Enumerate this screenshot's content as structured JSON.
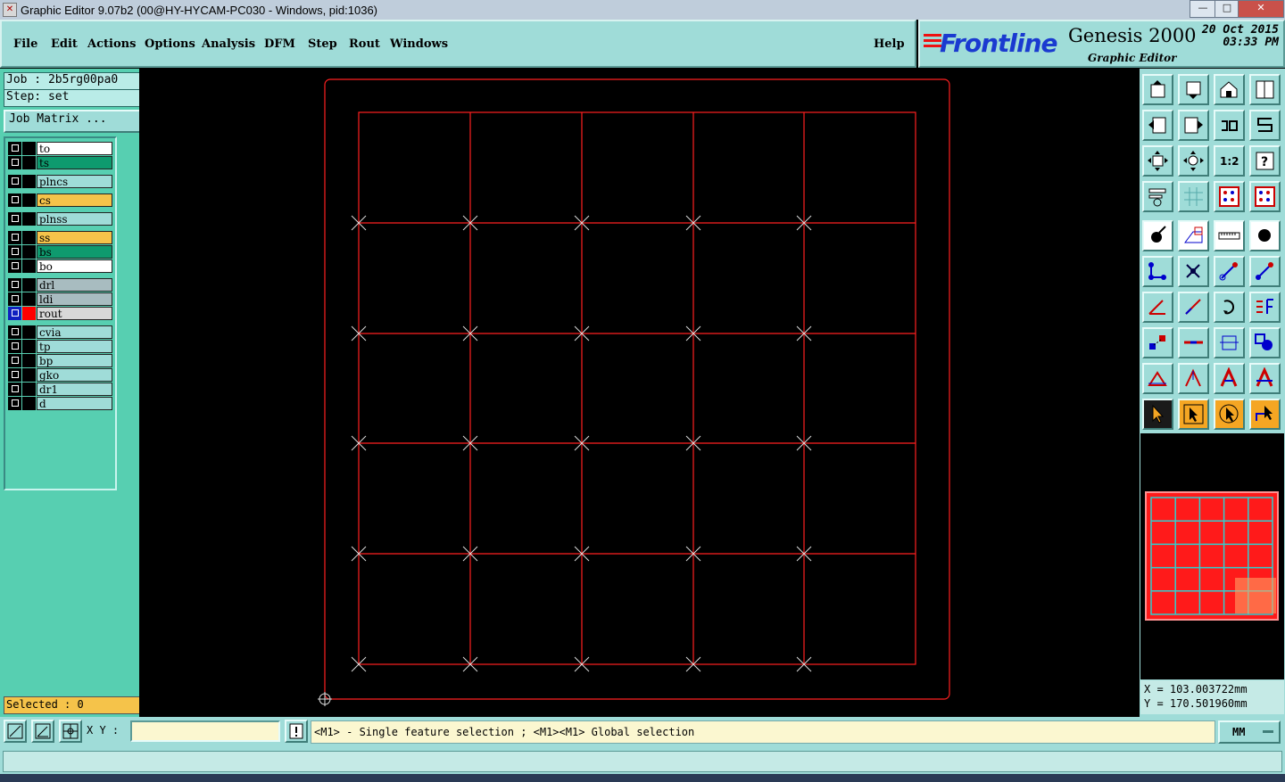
{
  "window": {
    "title": "Graphic Editor 9.07b2 (00@HY-HYCAM-PC030 - Windows, pid:1036)",
    "minimize": "—",
    "maximize": "□",
    "close": "✕"
  },
  "menubar": {
    "items": [
      "File",
      "Edit",
      "Actions",
      "Options",
      "Analysis",
      "DFM",
      "Step",
      "Rout",
      "Windows"
    ],
    "help": "Help"
  },
  "brand": {
    "logo": "Frontline",
    "app": "Genesis 2000",
    "subtitle": "Graphic Editor",
    "date": "20 Oct 2015",
    "time": "03:33 PM"
  },
  "job": {
    "job_label": "Job : 2b5rg00pa0",
    "step_label": "Step: set",
    "matrix_button": "Job Matrix ..."
  },
  "layers": [
    {
      "name": "to",
      "color": "#ffffff",
      "swatch": "#000000"
    },
    {
      "name": "ts",
      "color": "#0e9a6e",
      "swatch": "#000000"
    },
    {
      "name": "plncs",
      "color": "#9fdcd8",
      "swatch": "#000000"
    },
    {
      "name": "cs",
      "color": "#f5c34a",
      "swatch": "#000000"
    },
    {
      "name": "plnss",
      "color": "#9fdcd8",
      "swatch": "#000000"
    },
    {
      "name": "ss",
      "color": "#f5c34a",
      "swatch": "#000000"
    },
    {
      "name": "bs",
      "color": "#0e9a6e",
      "swatch": "#000000"
    },
    {
      "name": "bo",
      "color": "#ffffff",
      "swatch": "#000000"
    },
    {
      "name": "drl",
      "color": "#a8bcc0",
      "swatch": "#000000"
    },
    {
      "name": "ldi",
      "color": "#a8bcc0",
      "swatch": "#000000"
    },
    {
      "name": "rout",
      "color": "#d8d8d8",
      "swatch": "#ff0000",
      "active": true
    },
    {
      "name": "cvia",
      "color": "#9fdcd8",
      "swatch": "#000000"
    },
    {
      "name": "tp",
      "color": "#9fdcd8",
      "swatch": "#000000"
    },
    {
      "name": "bp",
      "color": "#9fdcd8",
      "swatch": "#000000"
    },
    {
      "name": "gko",
      "color": "#9fdcd8",
      "swatch": "#000000"
    },
    {
      "name": "dr1",
      "color": "#9fdcd8",
      "swatch": "#000000"
    },
    {
      "name": "d",
      "color": "#9fdcd8",
      "swatch": "#000000"
    }
  ],
  "selected_label": "Selected : 0",
  "coords": {
    "x": "X  =  103.003722mm",
    "y": "Y  =  170.501960mm"
  },
  "status": {
    "xy_label": "X Y :",
    "xy_value": "",
    "message": "<M1> - Single feature selection ; <M1><M1> Global selection",
    "unit": "MM"
  },
  "colors": {
    "rout_line": "#ff2020",
    "marker": "#dddddd",
    "panel": "#9fdcd8"
  }
}
